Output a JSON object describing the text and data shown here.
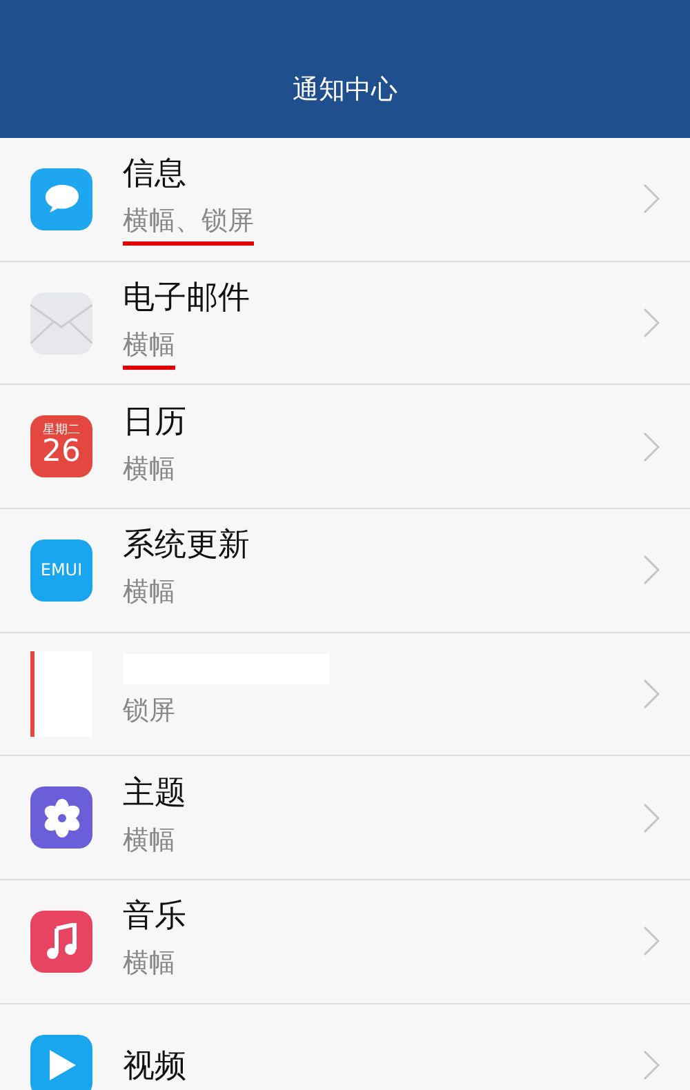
{
  "header": {
    "title": "通知中心"
  },
  "apps": [
    {
      "kind": "chat",
      "name": "信息",
      "subtitle": "横幅、锁屏",
      "underlined": true
    },
    {
      "kind": "mail",
      "name": "电子邮件",
      "subtitle": "横幅",
      "underlined": true
    },
    {
      "kind": "calendar",
      "icon_text": "星期二",
      "icon_number": "26",
      "name": "日历",
      "subtitle": "横幅",
      "underlined": false
    },
    {
      "kind": "emui",
      "icon_text": "EMUI",
      "name": "系统更新",
      "subtitle": "横幅",
      "underlined": false
    },
    {
      "kind": "redacted",
      "subtitle": "锁屏",
      "underlined": false
    },
    {
      "kind": "flower",
      "name": "主题",
      "subtitle": "横幅",
      "underlined": false
    },
    {
      "kind": "music",
      "name": "音乐",
      "subtitle": "横幅",
      "underlined": false
    },
    {
      "kind": "play",
      "name": "视频"
    }
  ]
}
